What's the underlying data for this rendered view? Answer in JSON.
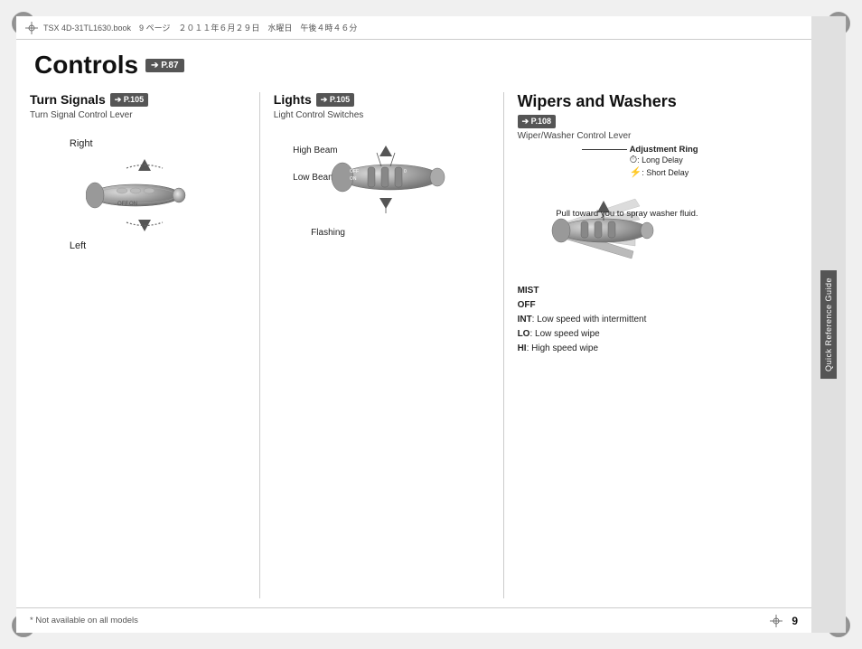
{
  "page": {
    "top_bar_text": "TSX 4D-31TL1630.book　9 ページ　２０１１年６月２９日　水曜日　午後４時４６分",
    "page_number": "9",
    "footer_note": "* Not available on all models"
  },
  "controls": {
    "main_title": "Controls",
    "main_ref": "➔ P.87",
    "turn_signals": {
      "title": "Turn Signals",
      "ref": "➔ P.105",
      "sub_label": "Turn Signal Control Lever",
      "label_right": "Right",
      "label_left": "Left"
    },
    "lights": {
      "title": "Lights",
      "ref": "➔ P.105",
      "sub_label": "Light Control Switches",
      "label_high_beam": "High Beam",
      "label_low_beam": "Low Beam",
      "label_flashing": "Flashing"
    },
    "wipers": {
      "title": "Wipers and Washers",
      "ref": "➔ P.108",
      "sub_label": "Wiper/Washer Control Lever",
      "adj_ring": "Adjustment Ring",
      "long_delay": ": Long Delay",
      "short_delay": ": Short Delay",
      "pull_label": "Pull toward\nyou to spray\nwasher fluid.",
      "mist": "MIST",
      "off": "OFF",
      "int": "INT",
      "int_desc": ": Low speed with intermittent",
      "lo": "LO",
      "lo_desc": ": Low speed wipe",
      "hi": "HI",
      "hi_desc": ": High speed wipe"
    }
  },
  "sidebar": {
    "label": "Quick Reference Guide"
  }
}
